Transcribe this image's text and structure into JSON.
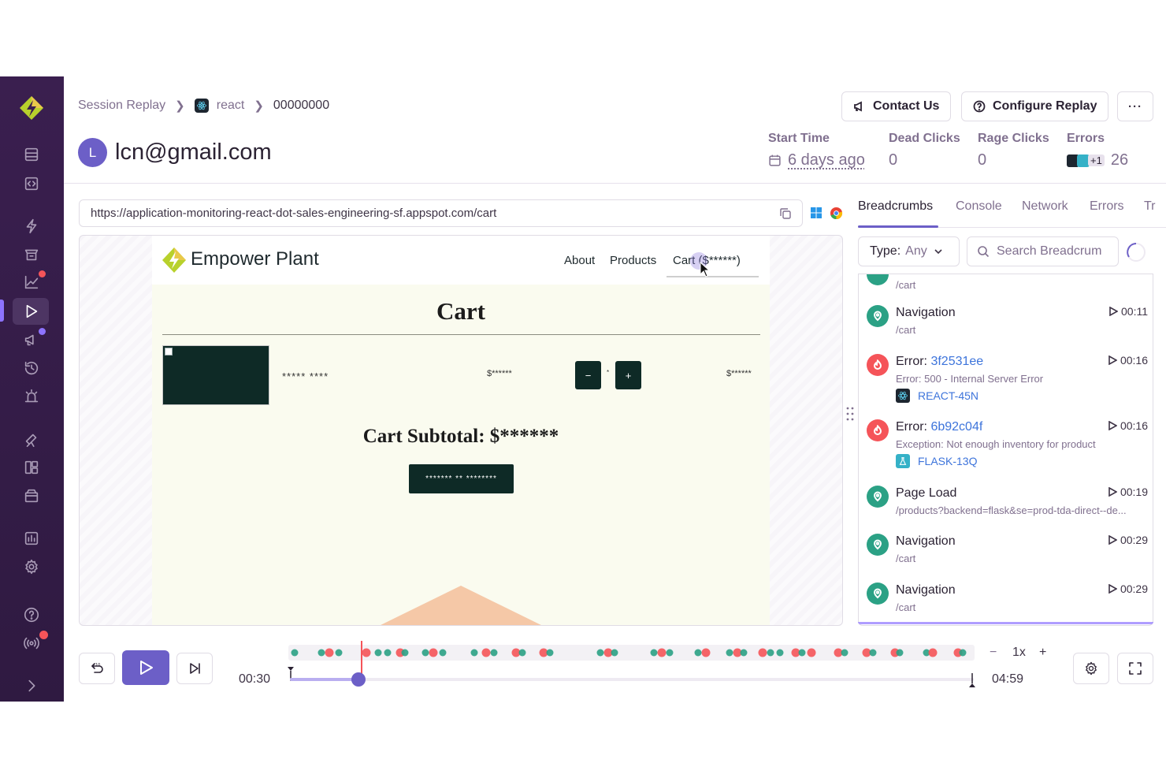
{
  "breadcrumb": {
    "root": "Session Replay",
    "project": "react",
    "replay_id": "00000000"
  },
  "user": {
    "initial": "L",
    "email": "lcn@gmail.com"
  },
  "header_buttons": {
    "contact": "Contact Us",
    "configure": "Configure Replay",
    "more": "···"
  },
  "metrics": {
    "start_time": {
      "label": "Start Time",
      "value": "6 days ago"
    },
    "dead_clicks": {
      "label": "Dead Clicks",
      "value": "0"
    },
    "rage_clicks": {
      "label": "Rage Clicks",
      "value": "0"
    },
    "errors": {
      "label": "Errors",
      "extra": "+1",
      "value": "26"
    }
  },
  "url": "https://application-monitoring-react-dot-sales-engineering-sf.appspot.com/cart",
  "site": {
    "title": "Empower Plant",
    "nav": {
      "about": "About",
      "products": "Products",
      "cart": "Cart ($******)"
    },
    "cart_heading": "Cart",
    "product_name": "***** ****",
    "product_price": "$******",
    "qty_minus": "−",
    "qty_value": "*",
    "qty_plus": "+",
    "line_total": "$******",
    "subtotal": "Cart Subtotal: $******",
    "checkout": "******* ** ********"
  },
  "panel": {
    "tabs": [
      "Breadcrumbs",
      "Console",
      "Network",
      "Errors",
      "Tr"
    ],
    "type_label": "Type:",
    "type_value": "Any",
    "search_placeholder": "Search Breadcrum",
    "top_partial_sub": "/cart",
    "items": [
      {
        "kind": "navigation",
        "title": "Navigation",
        "sub": "/cart",
        "time": "00:11"
      },
      {
        "kind": "error",
        "title_prefix": "Error: ",
        "title_link": "3f2531ee",
        "sub": "Error: 500 - Internal Server Error",
        "issue": "REACT-45N",
        "issue_platform": "react",
        "time": "00:16"
      },
      {
        "kind": "error",
        "title_prefix": "Error: ",
        "title_link": "6b92c04f",
        "sub": "Exception: Not enough inventory for product",
        "issue": "FLASK-13Q",
        "issue_platform": "flask",
        "time": "00:16"
      },
      {
        "kind": "pageload",
        "title": "Page Load",
        "sub": "/products?backend=flask&se=prod-tda-direct--de...",
        "time": "00:19"
      },
      {
        "kind": "navigation",
        "title": "Navigation",
        "sub": "/cart",
        "time": "00:29"
      },
      {
        "kind": "navigation",
        "title": "Navigation",
        "sub": "/cart",
        "time": "00:29"
      }
    ]
  },
  "player": {
    "current_time": "00:30",
    "duration": "04:59",
    "progress": 0.1,
    "speed": "1x",
    "speed_minus": "−",
    "speed_plus": "+"
  },
  "colors": {
    "accent": "#6c5fc7",
    "sidebar": "#3a1f4f",
    "nav_green": "#2ba185",
    "error_red": "#f55459",
    "link_blue": "#3d74db"
  }
}
